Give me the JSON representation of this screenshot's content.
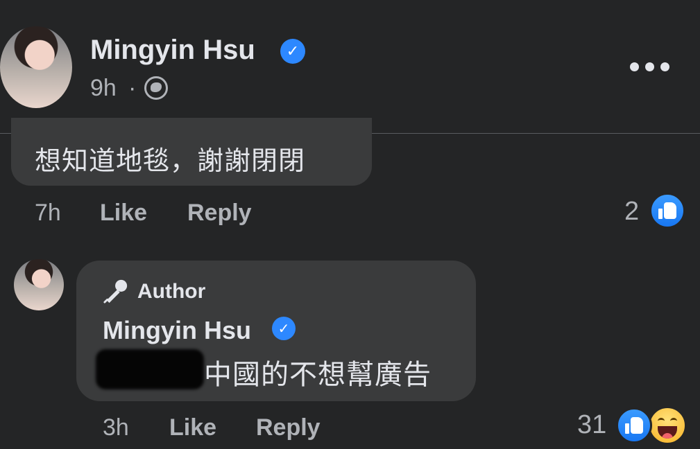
{
  "post": {
    "author_name": "Mingyin Hsu",
    "verified_icon": "verified-badge-icon",
    "time": "9h",
    "separator": "·",
    "audience_icon": "globe-icon",
    "more_icon": "more-options-icon"
  },
  "comment1": {
    "text": "想知道地毯，謝謝閉閉",
    "time": "7h",
    "like_label": "Like",
    "reply_label": "Reply",
    "reaction_count": "2",
    "reactions": [
      "like-reaction-icon"
    ]
  },
  "reply": {
    "badge_icon": "microphone-icon",
    "badge_label": "Author",
    "author_name": "Mingyin Hsu",
    "text": "中國的不想幫廣告",
    "time": "3h",
    "like_label": "Like",
    "reply_label": "Reply",
    "reaction_count": "31",
    "reactions": [
      "like-reaction-icon",
      "haha-reaction-icon"
    ]
  },
  "colors": {
    "background": "#242526",
    "bubble": "#3a3b3c",
    "primary_text": "#e4e6eb",
    "secondary_text": "#b0b3b8",
    "accent": "#2d88ff"
  }
}
